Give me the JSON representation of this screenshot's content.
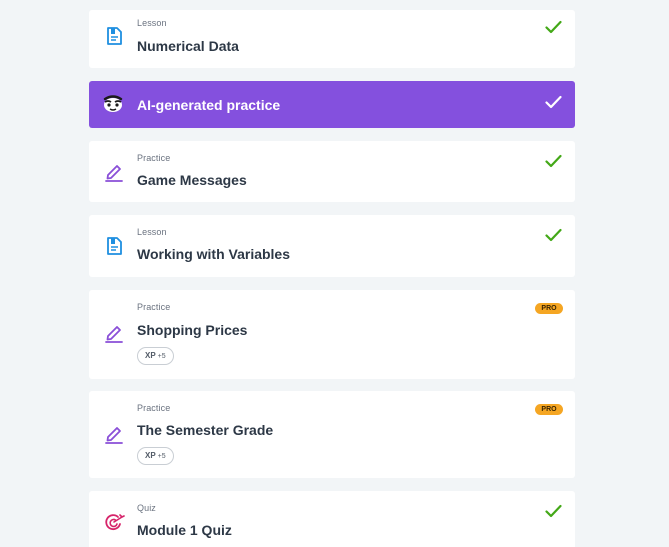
{
  "items": [
    {
      "type": "Lesson",
      "title": "Numerical Data",
      "icon": "lesson-doc-icon",
      "status": "completed"
    },
    {
      "title": "AI-generated practice",
      "icon": "ai-robot-icon",
      "status": "completed"
    },
    {
      "type": "Practice",
      "title": "Game Messages",
      "icon": "practice-pencil-icon",
      "status": "completed"
    },
    {
      "type": "Lesson",
      "title": "Working with Variables",
      "icon": "lesson-doc-icon",
      "status": "completed"
    },
    {
      "type": "Practice",
      "title": "Shopping Prices",
      "icon": "practice-pencil-icon",
      "badge": "PRO",
      "xp_label": "XP",
      "xp_value": "+5"
    },
    {
      "type": "Practice",
      "title": "The Semester Grade",
      "icon": "practice-pencil-icon",
      "badge": "PRO",
      "xp_label": "XP",
      "xp_value": "+5"
    },
    {
      "type": "Quiz",
      "title": "Module 1 Quiz",
      "icon": "quiz-target-icon",
      "status": "completed"
    }
  ],
  "colors": {
    "background": "#f2f5f7",
    "card": "#ffffff",
    "ai_accent": "#8450de",
    "check": "#43a817",
    "pro_badge": "#f5a623",
    "lesson_icon": "#1f8fe0",
    "practice_icon": "#8a4fd8",
    "quiz_icon": "#d6246a"
  }
}
